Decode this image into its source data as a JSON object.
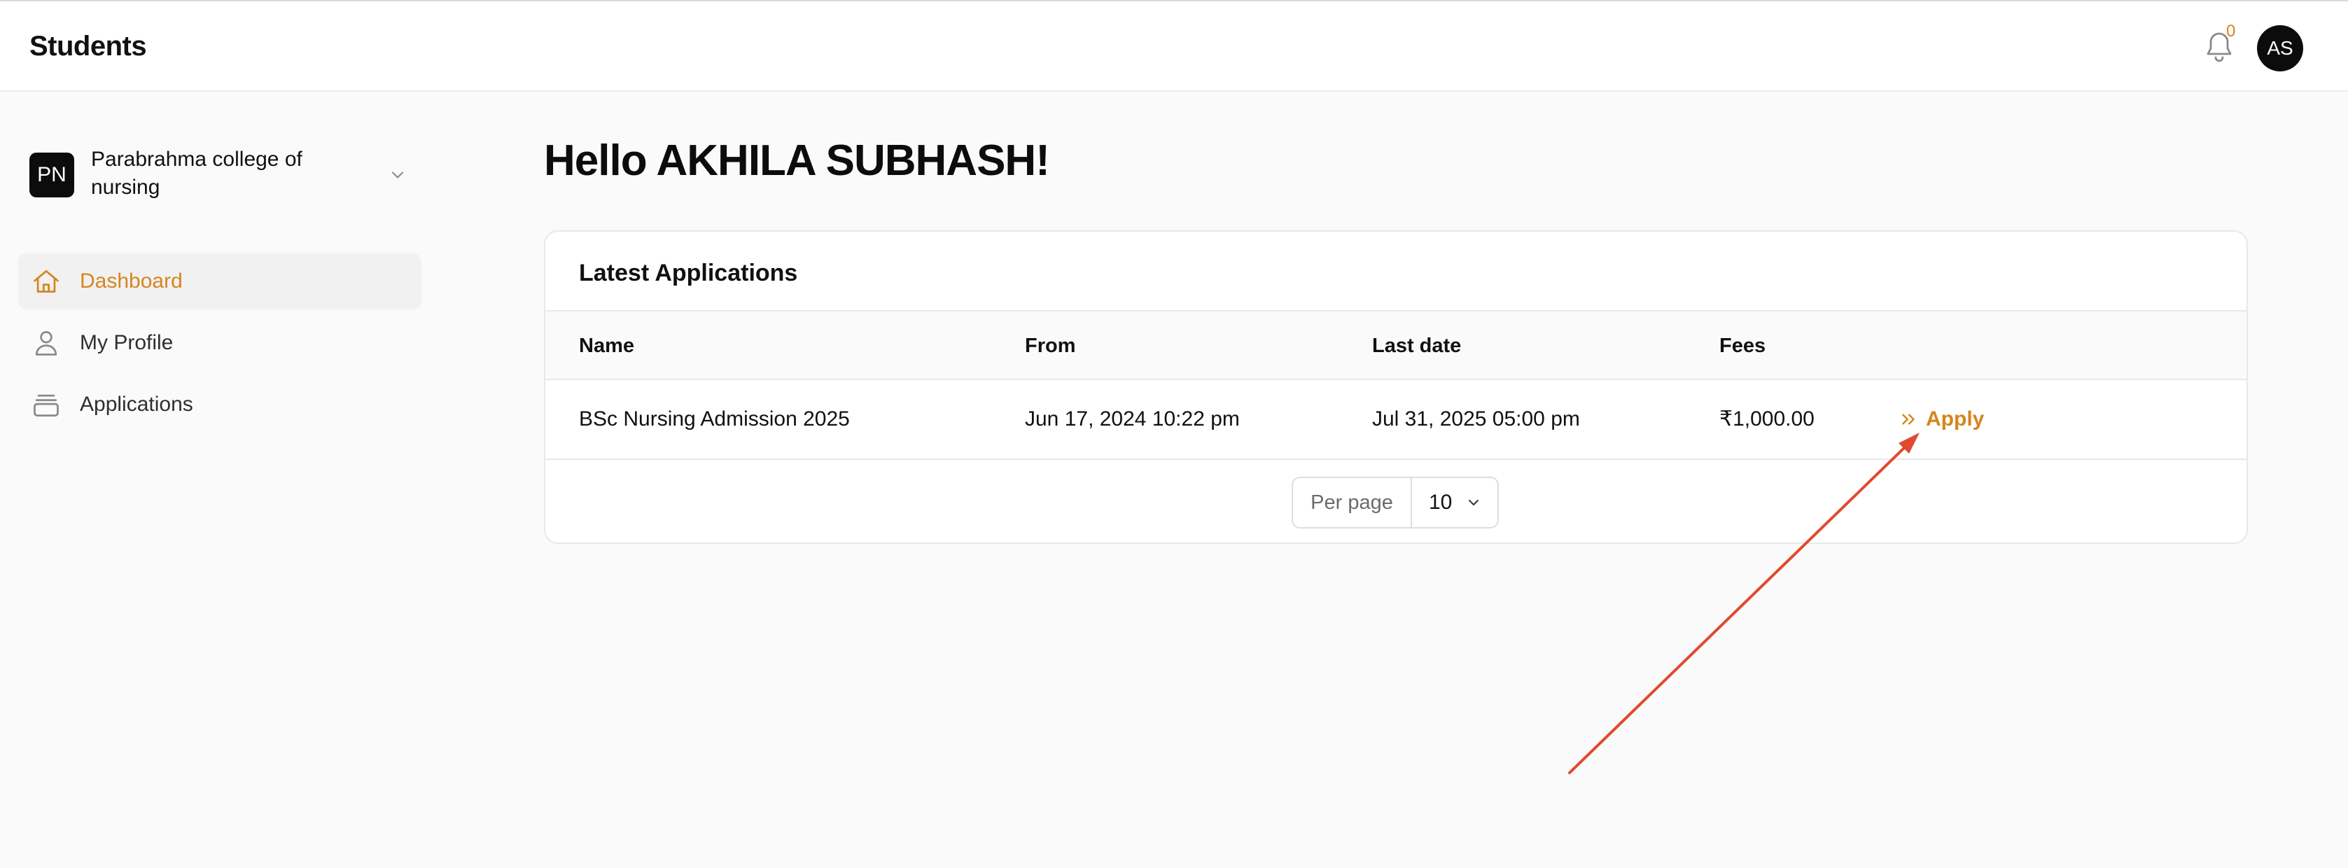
{
  "header": {
    "title": "Students",
    "notification_count": "0",
    "avatar_initials": "AS"
  },
  "sidebar": {
    "org": {
      "logo_initials": "PN",
      "name": "Parabrahma college of nursing"
    },
    "items": [
      {
        "label": "Dashboard",
        "icon": "home-icon",
        "active": true
      },
      {
        "label": "My Profile",
        "icon": "user-icon",
        "active": false
      },
      {
        "label": "Applications",
        "icon": "archive-box-icon",
        "active": false
      }
    ]
  },
  "main": {
    "greeting": "Hello AKHILA SUBHASH!",
    "card": {
      "title": "Latest Applications",
      "columns": [
        "Name",
        "From",
        "Last date",
        "Fees"
      ],
      "rows": [
        {
          "name": "BSc Nursing Admission 2025",
          "from": "Jun 17, 2024 10:22 pm",
          "last_date": "Jul 31, 2025 05:00 pm",
          "fees": "₹1,000.00",
          "action_label": "Apply",
          "action_icon": "chevrons-right-icon"
        }
      ],
      "pagination": {
        "per_page_label": "Per page",
        "per_page_value": "10"
      }
    }
  },
  "colors": {
    "accent": "#d5861e",
    "annotation_arrow": "#e04a2f",
    "page_background": "#fafafa",
    "logo_background": "#0c0c0c"
  }
}
